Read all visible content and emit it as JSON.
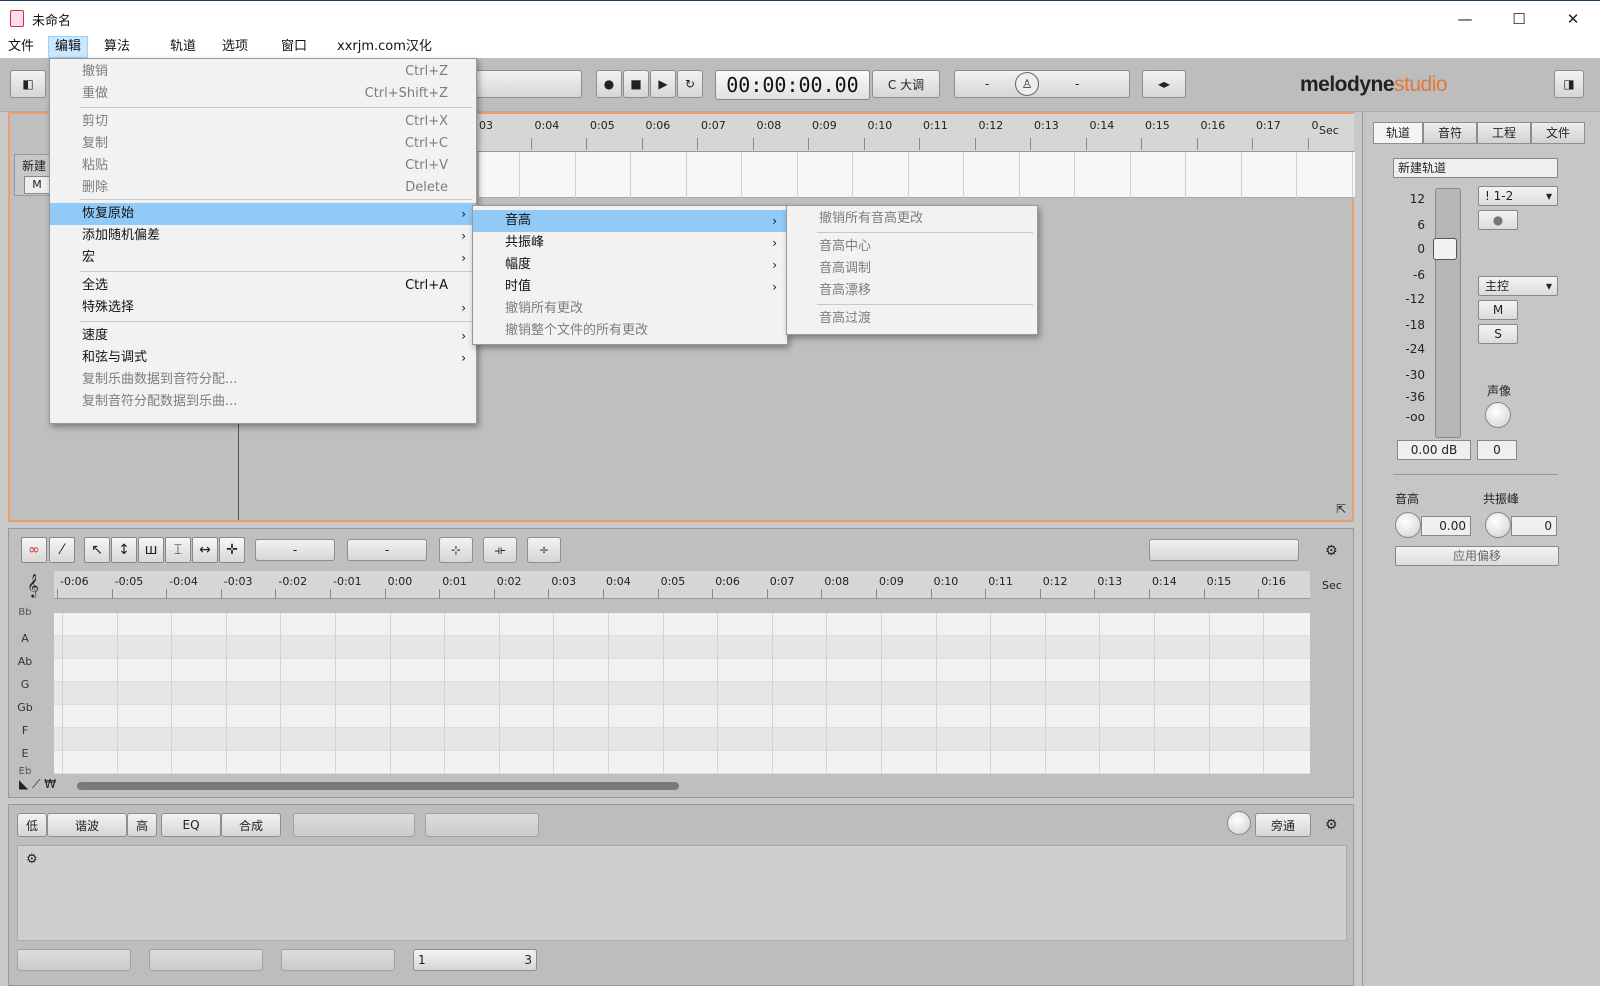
{
  "window": {
    "title": "未命名",
    "minimize": "—",
    "maximize": "☐",
    "close": "✕"
  },
  "menubar": [
    "文件",
    "编辑",
    "算法",
    "轨道",
    "选项",
    "窗口",
    "xxrjm.com汉化"
  ],
  "toolbar": {
    "time": "00:00:00.00",
    "key": "C 大调",
    "dash1": "-",
    "dash2": "-"
  },
  "logo": {
    "main": "melodyne",
    "edition": "studio"
  },
  "arrange": {
    "ticks": [
      "03",
      "0:04",
      "0:05",
      "0:06",
      "0:07",
      "0:08",
      "0:09",
      "0:10",
      "0:11",
      "0:12",
      "0:13",
      "0:14",
      "0:15",
      "0:16",
      "0:17",
      "0"
    ],
    "sec": "Sec",
    "track_name": "新建",
    "mute": "M"
  },
  "inspector": {
    "tabs": [
      "轨道",
      "音符",
      "工程",
      "文件"
    ],
    "track_name": "新建轨道",
    "db_scale": [
      "12",
      "6",
      "0",
      "-6",
      "-12",
      "-18",
      "-24",
      "-30",
      "-36",
      "-oo"
    ],
    "io": "! 1-2",
    "master": "主控",
    "m": "M",
    "s": "S",
    "pan_label": "声像",
    "gain": "0.00 dB",
    "pan": "0",
    "pitch_label": "音高",
    "pitch_value": "0.00",
    "formant_label": "共振峰",
    "formant_value": "0",
    "apply": "应用偏移"
  },
  "editor": {
    "dash1": "-",
    "dash2": "-",
    "ticks": [
      "-0:06",
      "-0:05",
      "-0:04",
      "-0:03",
      "-0:02",
      "-0:01",
      "0:00",
      "0:01",
      "0:02",
      "0:03",
      "0:04",
      "0:05",
      "0:06",
      "0:07",
      "0:08",
      "0:09",
      "0:10",
      "0:11",
      "0:12",
      "0:13",
      "0:14",
      "0:15",
      "0:16"
    ],
    "sec": "Sec",
    "keys": [
      "Bb",
      "A",
      "Ab",
      "G",
      "Gb",
      "F",
      "E",
      "Eb"
    ]
  },
  "bottom": {
    "low": "低",
    "filter": "谐波",
    "high": "高",
    "eq": "EQ",
    "synth": "合成",
    "bypass": "旁通",
    "one": "1",
    "three": "3"
  },
  "edit_menu": {
    "items": [
      {
        "label": "撤销",
        "shortcut": "Ctrl+Z",
        "disabled": true
      },
      {
        "label": "重做",
        "shortcut": "Ctrl+Shift+Z",
        "disabled": true
      },
      {
        "label": "剪切",
        "shortcut": "Ctrl+X",
        "disabled": true
      },
      {
        "label": "复制",
        "shortcut": "Ctrl+C",
        "disabled": true
      },
      {
        "label": "粘贴",
        "shortcut": "Ctrl+V",
        "disabled": true
      },
      {
        "label": "删除",
        "shortcut": "Delete",
        "disabled": true
      },
      {
        "label": "恢复原始",
        "submenu": true,
        "highlight": true
      },
      {
        "label": "添加随机偏差",
        "submenu": true
      },
      {
        "label": "宏",
        "submenu": true
      },
      {
        "label": "全选",
        "shortcut": "Ctrl+A"
      },
      {
        "label": "特殊选择",
        "submenu": true
      },
      {
        "label": "速度",
        "submenu": true
      },
      {
        "label": "和弦与调式",
        "submenu": true
      },
      {
        "label": "复制乐曲数据到音符分配...",
        "disabled": true
      },
      {
        "label": "复制音符分配数据到乐曲...",
        "disabled": true
      }
    ]
  },
  "restore_menu": {
    "items": [
      {
        "label": "音高",
        "submenu": true,
        "highlight": true
      },
      {
        "label": "共振峰",
        "submenu": true
      },
      {
        "label": "幅度",
        "submenu": true
      },
      {
        "label": "时值",
        "submenu": true
      },
      {
        "label": "撤销所有更改",
        "disabled": true
      },
      {
        "label": "撤销整个文件的所有更改",
        "disabled": true
      }
    ]
  },
  "pitch_menu": {
    "items": [
      {
        "label": "撤销所有音高更改",
        "disabled": true
      },
      {
        "label": "音高中心",
        "disabled": true
      },
      {
        "label": "音高调制",
        "disabled": true
      },
      {
        "label": "音高漂移",
        "disabled": true
      },
      {
        "label": "音高过渡",
        "disabled": true
      }
    ]
  },
  "arrow": "›"
}
